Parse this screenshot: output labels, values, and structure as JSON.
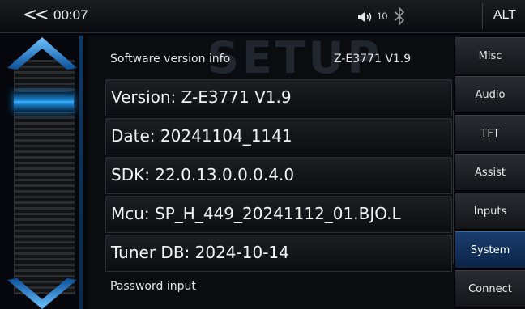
{
  "status": {
    "back_icon": "double-chevron-left-icon",
    "time": "00:07",
    "volume": "10",
    "speaker_icon": "speaker-icon",
    "bluetooth_icon": "bluetooth-icon",
    "alt_label": "ALT"
  },
  "watermark": "SETUP",
  "main": {
    "header_label": "Software version info",
    "header_value": "Z-E3771 V1.9",
    "rows": [
      {
        "label": "Version: Z-E3771 V1.9"
      },
      {
        "label": "Date: 20241104_1141"
      },
      {
        "label": "SDK: 22.0.13.0.0.0.4.0"
      },
      {
        "label": "Mcu: SP_H_449_20241112_01.BJO.L"
      },
      {
        "label": "Tuner DB: 2024-10-14"
      }
    ],
    "password_label": "Password input"
  },
  "tabs": [
    {
      "label": "Misc"
    },
    {
      "label": "Audio"
    },
    {
      "label": "TFT"
    },
    {
      "label": "Assist"
    },
    {
      "label": "Inputs"
    },
    {
      "label": "System",
      "active": true
    },
    {
      "label": "Connect"
    }
  ],
  "colors": {
    "accent": "#1c8fe0",
    "active_tab": "#1a3d6e"
  }
}
